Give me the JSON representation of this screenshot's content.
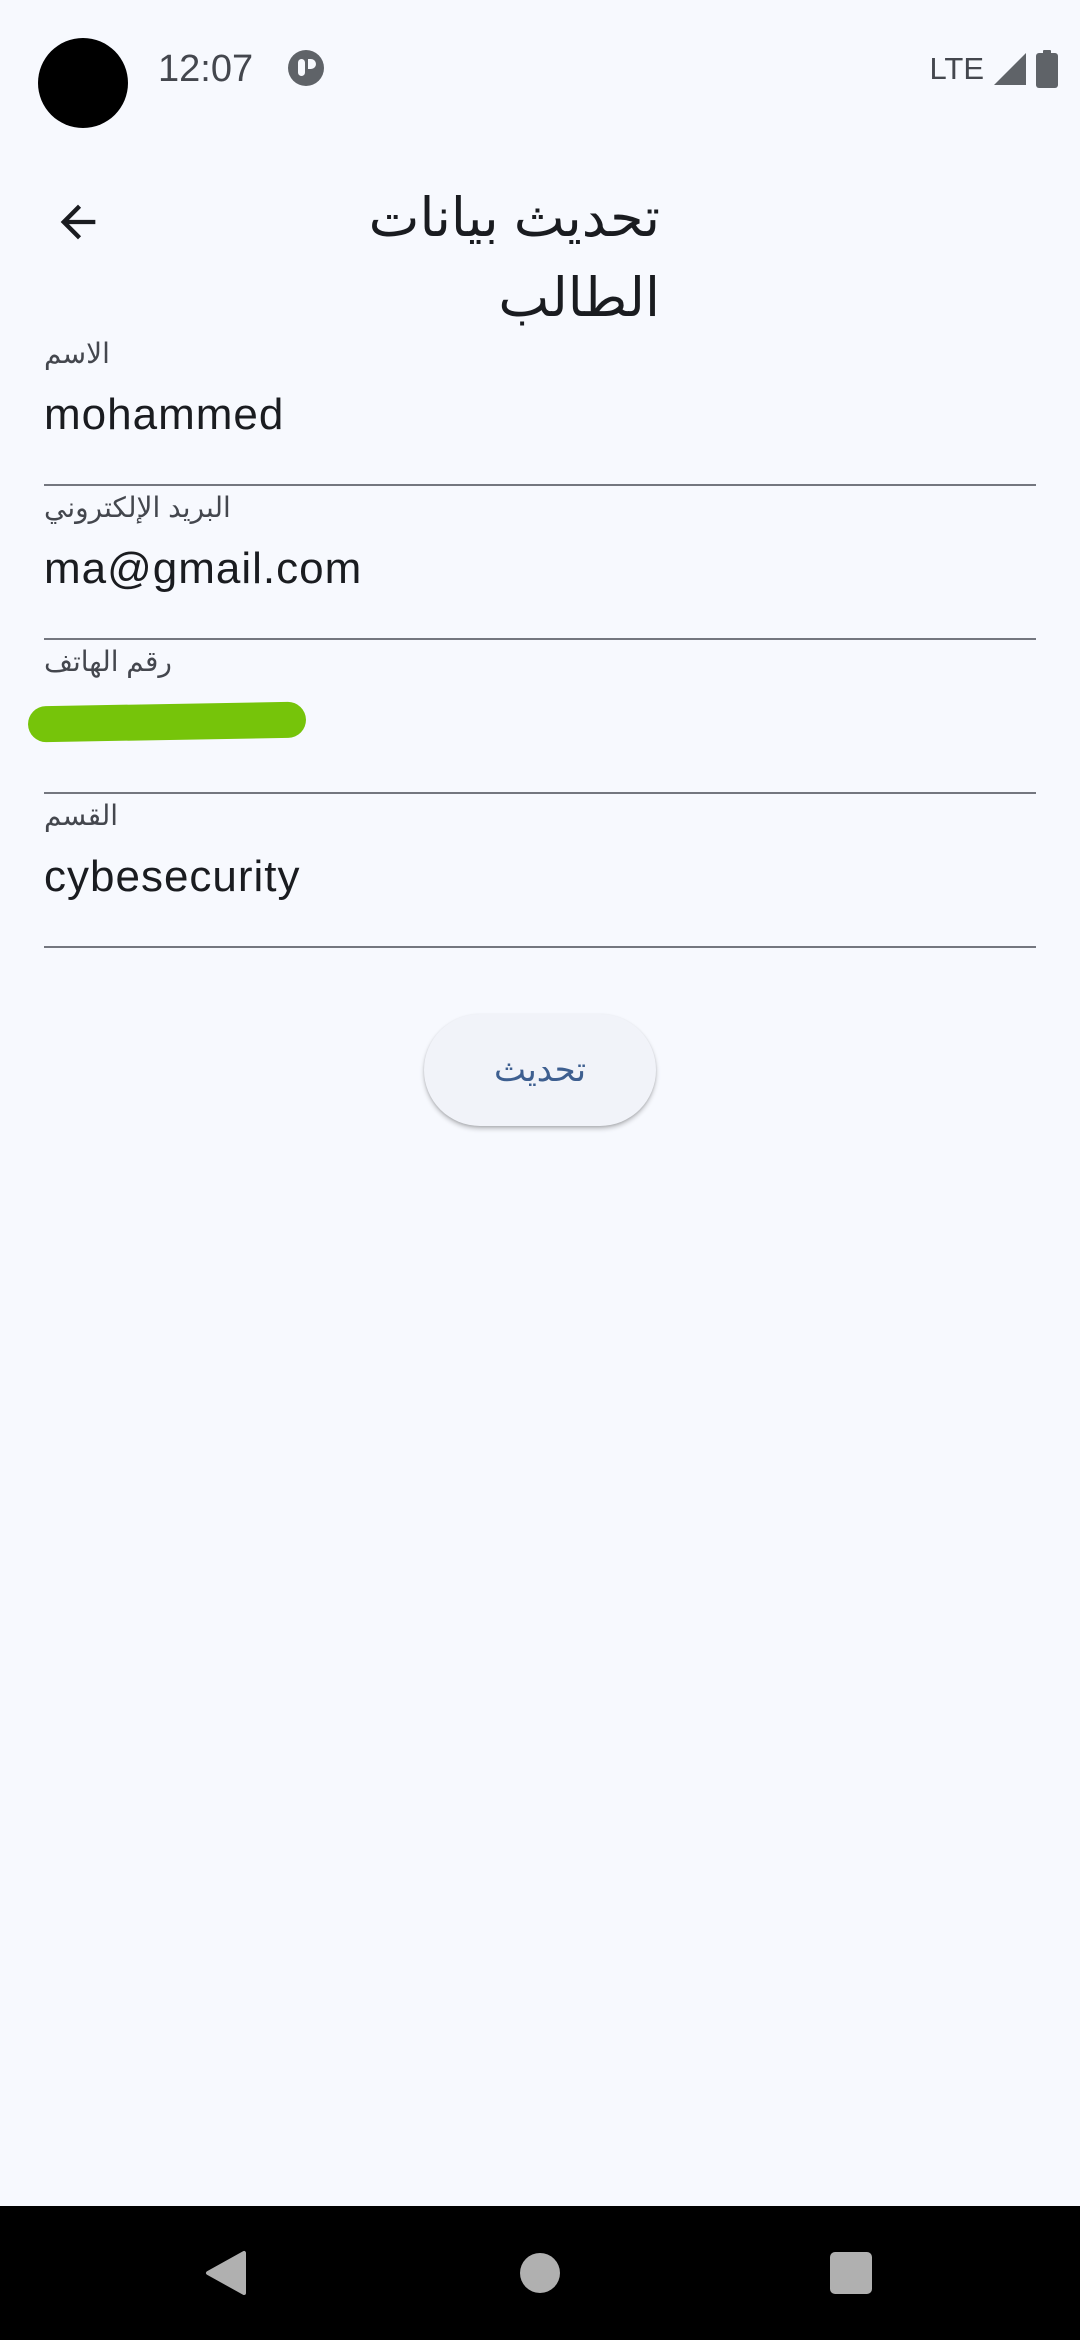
{
  "status_bar": {
    "time": "12:07",
    "network": "LTE",
    "icons": [
      "app-notification-icon",
      "signal-icon",
      "battery-icon"
    ]
  },
  "header": {
    "title": "تحديث بيانات الطالب",
    "back_icon": "arrow-left-icon"
  },
  "form": {
    "name": {
      "label": "الاسم",
      "value": "mohammed"
    },
    "email": {
      "label": "البريد الإلكتروني",
      "value": "ma@gmail.com"
    },
    "phone": {
      "label": "رقم الهاتف",
      "value": "",
      "redacted": true
    },
    "department": {
      "label": "القسم",
      "value": "cybesecurity"
    }
  },
  "actions": {
    "update_label": "تحديث"
  },
  "colors": {
    "background": "#f7f9fe",
    "text": "#1a1c20",
    "label": "#44474e",
    "button_text": "#3e5f90",
    "redaction": "#76c40a"
  },
  "nav_bar": {
    "icons": [
      "nav-back-icon",
      "nav-home-icon",
      "nav-recents-icon"
    ]
  }
}
